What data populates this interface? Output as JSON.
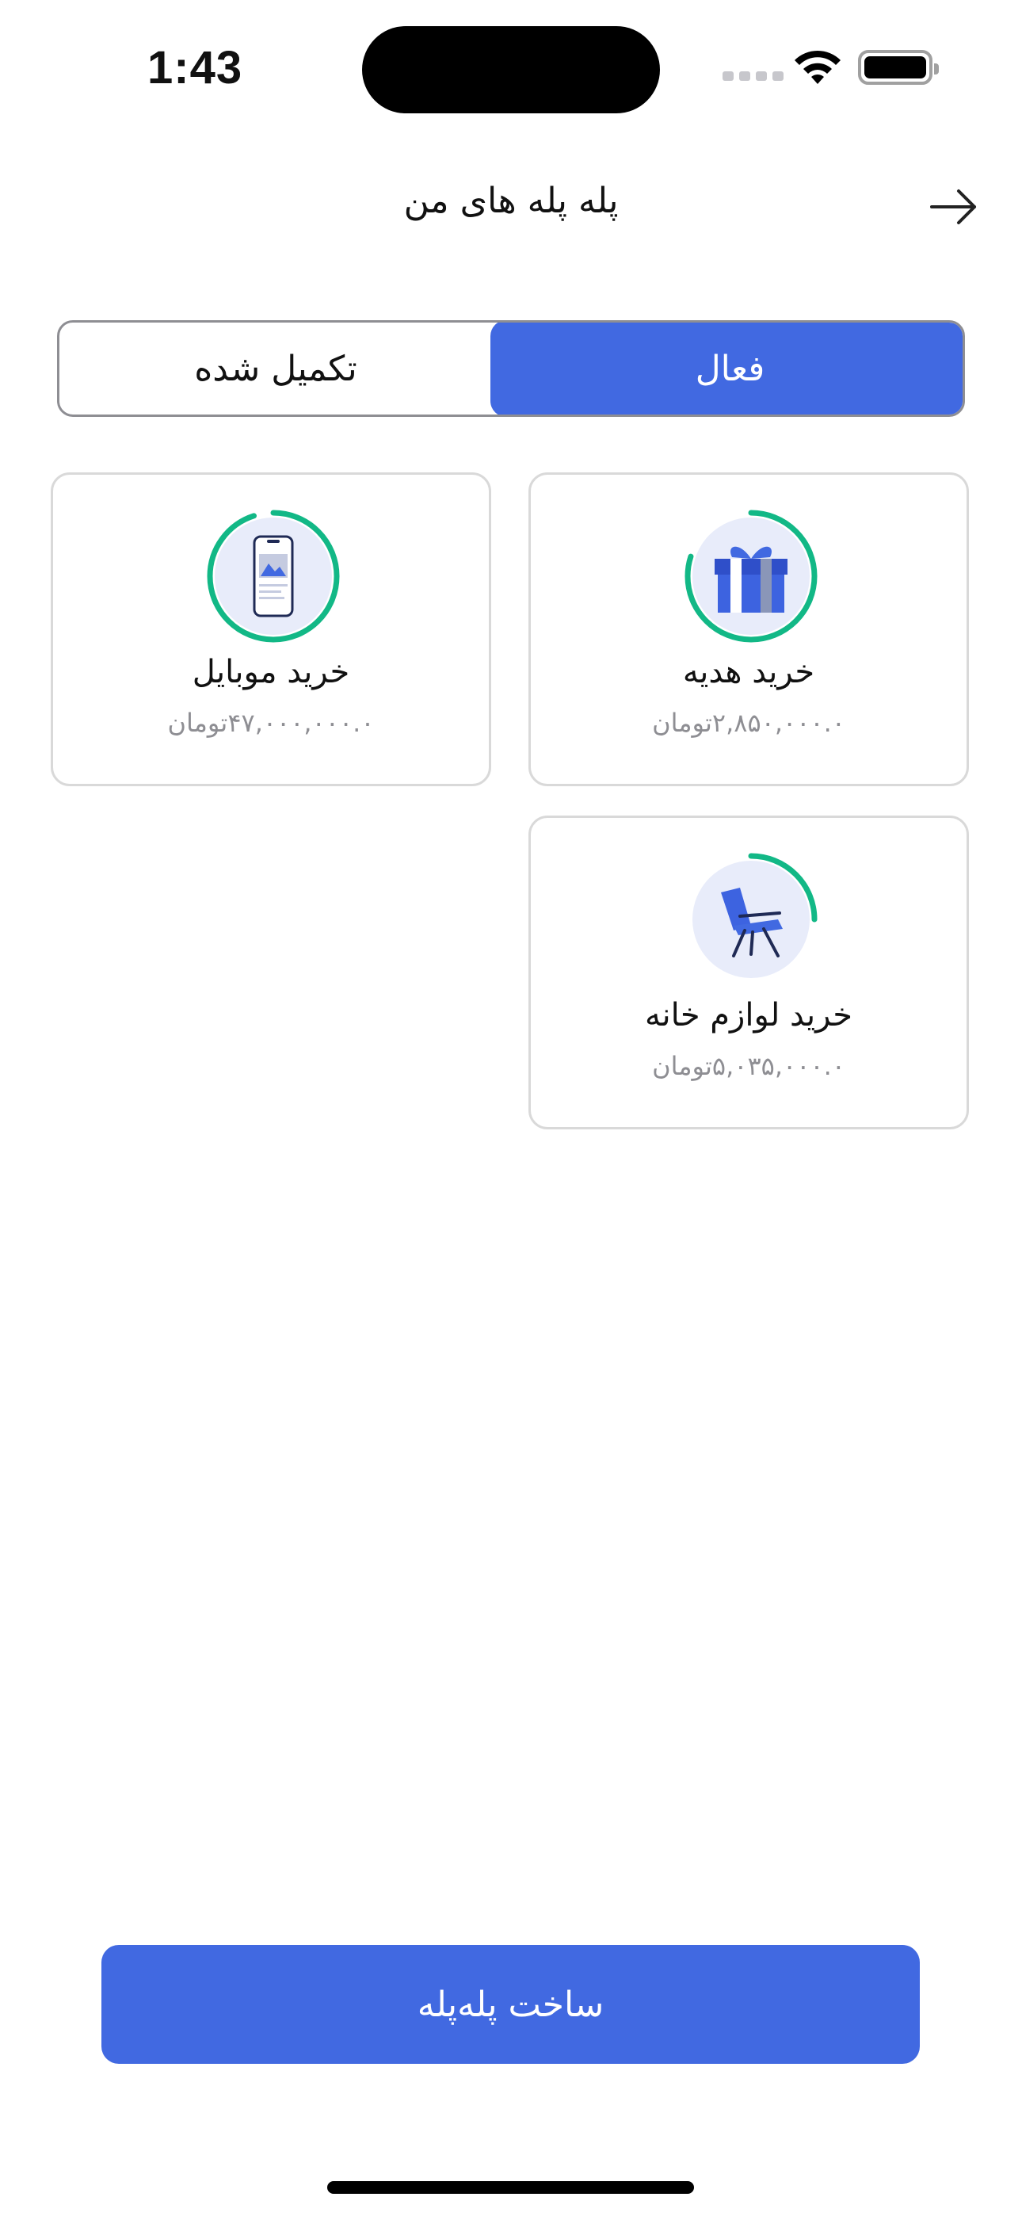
{
  "status_bar": {
    "time": "1:43"
  },
  "header": {
    "title": "پله پله های من",
    "back_icon": "arrow-right-icon"
  },
  "tabs": {
    "active_label": "فعال",
    "completed_label": "تکمیل شده",
    "selected": "active"
  },
  "cards": [
    {
      "id": "gift",
      "title": "خرید هدیه",
      "amount": "۲,۸۵۰,۰۰۰.۰تومان",
      "icon": "gift-icon",
      "progress": 0.8
    },
    {
      "id": "mobile",
      "title": "خرید موبایل",
      "amount": "۴۷,۰۰۰,۰۰۰.۰تومان",
      "icon": "mobile-phone-icon",
      "progress": 0.95
    },
    {
      "id": "home",
      "title": "خرید لوازم خانه",
      "amount": "۵,۰۳۵,۰۰۰.۰تومان",
      "icon": "armchair-icon",
      "progress": 0.25
    }
  ],
  "create_button": {
    "label": "ساخت پله‌پله"
  },
  "colors": {
    "primary": "#4169e1",
    "progress": "#12b886",
    "icon_bg": "#e8ecfa",
    "border": "#d9d9d9",
    "muted": "#8e8e93"
  }
}
